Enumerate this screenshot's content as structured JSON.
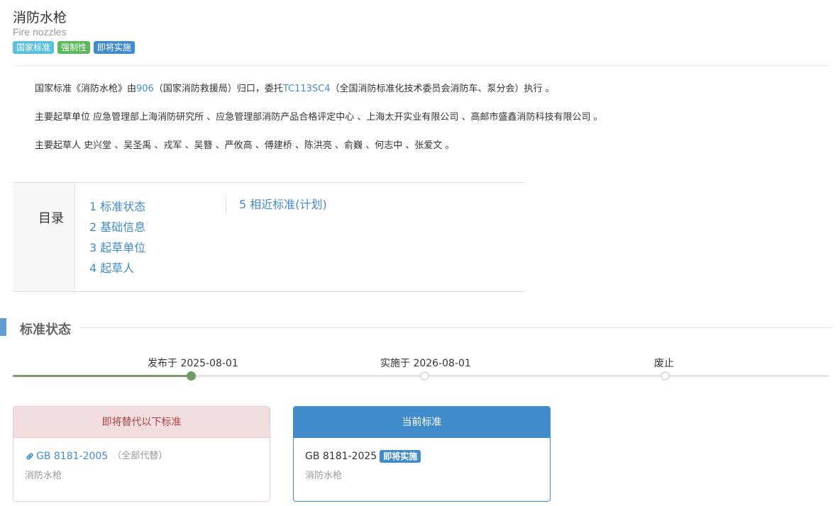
{
  "header": {
    "title": "消防水枪",
    "subtitle": "Fire nozzles",
    "badges": [
      "国家标准",
      "强制性",
      "即将实施"
    ]
  },
  "description": {
    "line1_prefix": "国家标准《消防水枪》由",
    "line1_link1": "906",
    "line1_mid": "（国家消防救援局）归口，委托",
    "line1_link2": "TC113SC4",
    "line1_suffix": "（全国消防标准化技术委员会消防车、泵分会）执行 。",
    "line2": "主要起草单位 应急管理部上海消防研究所 、应急管理部消防产品合格评定中心 、上海太开实业有限公司 、高邮市盛鑫消防科技有限公司 。",
    "line3": "主要起草人 史兴堂 、吴圣禹 、戎军 、吴簪 、严攸高 、傅建桥 、陈洪亮 、俞巍 、何志中 、张爱文 。"
  },
  "toc": {
    "title": "目录",
    "items": [
      "1  标准状态",
      "2  基础信息",
      "3  起草单位",
      "4  起草人",
      "5  相近标准(计划)"
    ]
  },
  "status_section": {
    "title": "标准状态",
    "timeline": {
      "published": "发布于 2025-08-01",
      "implemented": "实施于 2026-08-01",
      "abolished": "废止",
      "progress_fraction": 0.22
    }
  },
  "replace_panel": {
    "heading": "即将替代以下标准",
    "code": "GB 8181-2005",
    "note": "（全部代替）",
    "name": "消防水枪"
  },
  "current_panel": {
    "heading": "当前标准",
    "code": "GB 8181-2025",
    "badge": "即将实施",
    "name": "消防水枪"
  },
  "colors": {
    "primary": "#428bca",
    "success": "#5cb85c",
    "info": "#5bc0de",
    "danger_bg": "#f2dede",
    "timeline_done": "#6f9a64"
  }
}
